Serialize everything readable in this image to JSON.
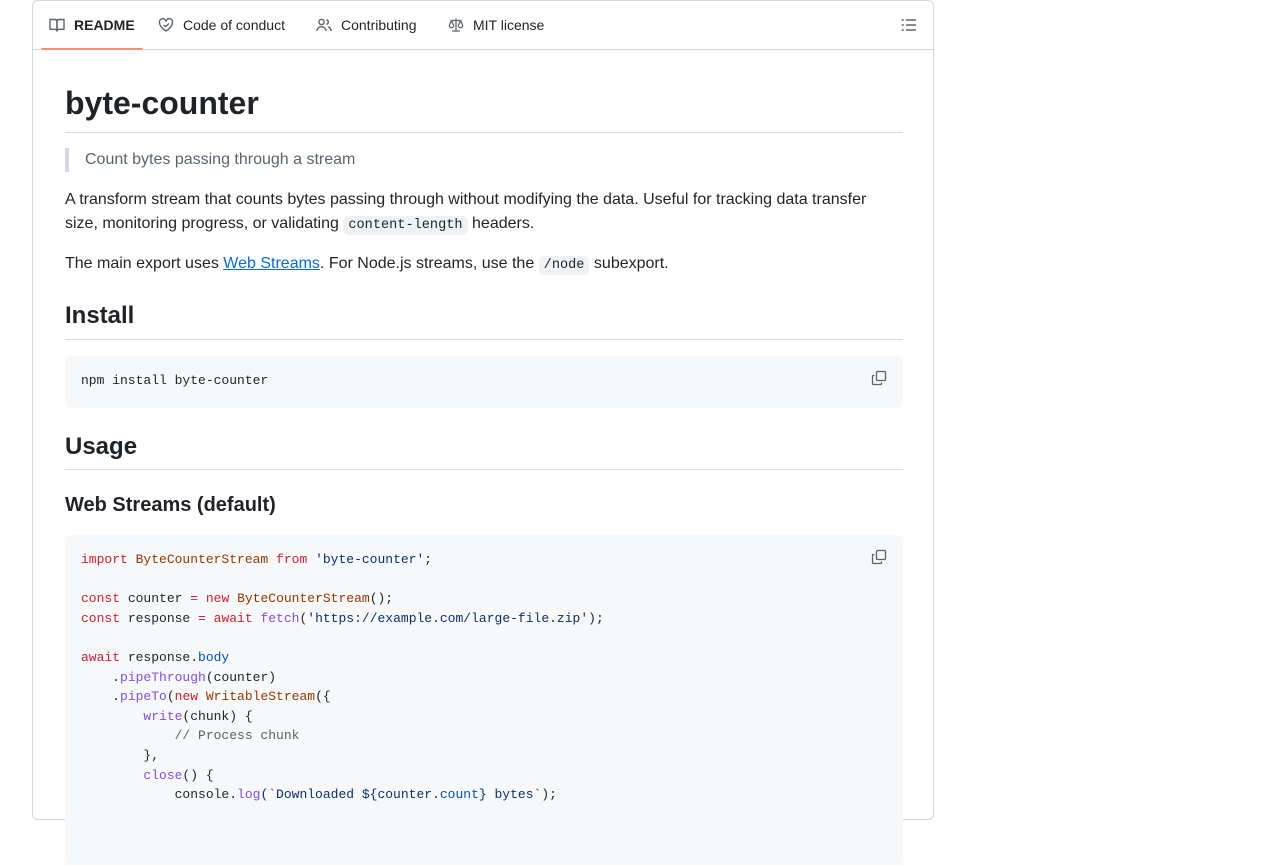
{
  "tabs": {
    "readme": "README",
    "code_of_conduct": "Code of conduct",
    "contributing": "Contributing",
    "license": "MIT license"
  },
  "title": "byte-counter",
  "quote": "Count bytes passing through a stream",
  "intro": {
    "before": "A transform stream that counts bytes passing through without modifying the data. Useful for tracking data transfer size, monitoring progress, or validating ",
    "code": "content-length",
    "after": " headers."
  },
  "main_export": {
    "before": "The main export uses ",
    "link": "Web Streams",
    "middle": ". For Node.js streams, use the ",
    "code": "/node",
    "after": " subexport."
  },
  "install": {
    "heading": "Install",
    "command": "npm install byte-counter"
  },
  "usage": {
    "heading": "Usage",
    "subheading": "Web Streams (default)",
    "code": {
      "l1_import": "import",
      "l1_name": " ByteCounterStream ",
      "l1_from": "from",
      "l1_str": " 'byte-counter'",
      "l1_end": ";",
      "l3_const": "const",
      "l3_var": " counter ",
      "l3_eq": "=",
      "l3_new": " new",
      "l3_cls": " ByteCounterStream",
      "l3_end": "();",
      "l4_const": "const",
      "l4_var": " response ",
      "l4_eq": "=",
      "l4_await": " await",
      "l4_fn": " fetch",
      "l4_open": "(",
      "l4_str": "'https://example.com/large-file.zip'",
      "l4_end": ");",
      "l6_await": "await",
      "l6_var": " response.",
      "l6_prop": "body",
      "l7_dot": "    .",
      "l7_fn": "pipeThrough",
      "l7_rest": "(counter)",
      "l8_dot": "    .",
      "l8_fn": "pipeTo",
      "l8_open": "(",
      "l8_new": "new",
      "l8_cls": " WritableStream",
      "l8_end": "({",
      "l9_fn": "        write",
      "l9_rest": "(chunk) {",
      "l10_comment": "            // Process chunk",
      "l11": "        },",
      "l12_fn": "        close",
      "l12_rest": "() {",
      "l13_a": "            console.",
      "l13_fn": "log",
      "l13_b": "(`Downloaded ${counter.",
      "l13_prop": "count",
      "l13_c": "} bytes`",
      "l13_d": ");"
    }
  },
  "icons": {
    "readme": "book-icon",
    "code_of_conduct": "heart-icon",
    "contributing": "people-icon",
    "license": "law-scale-icon",
    "toc": "list-unordered-icon",
    "copy": "copy-icon"
  }
}
